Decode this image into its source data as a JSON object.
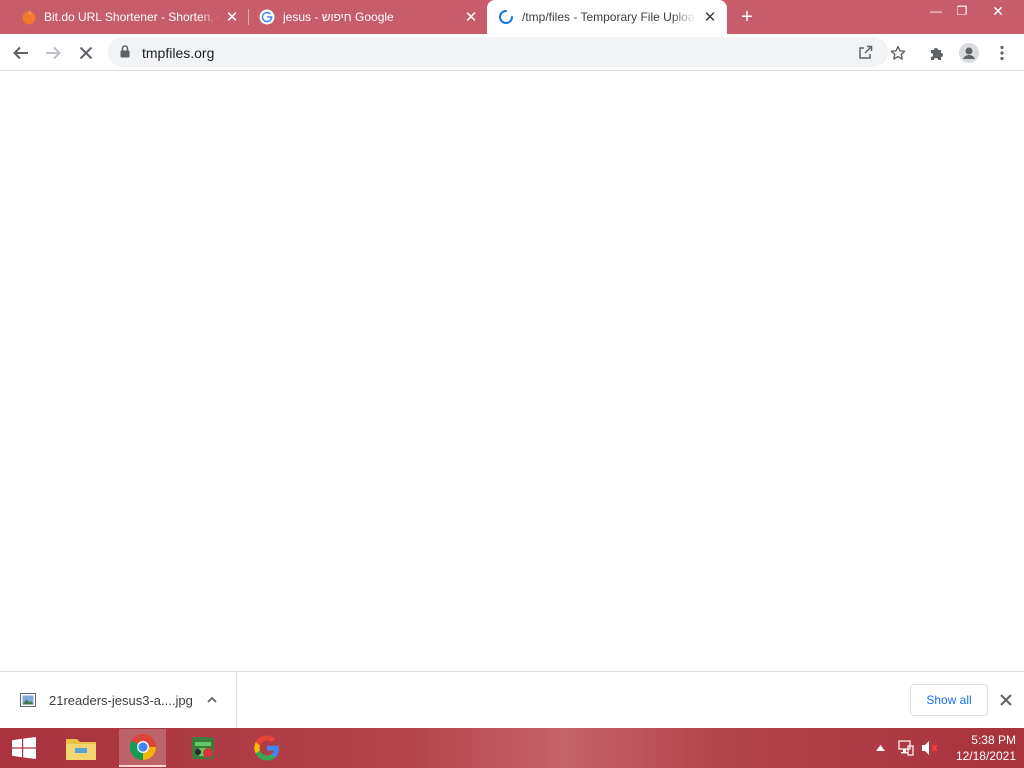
{
  "browser": {
    "tabs": [
      {
        "title": "Bit.do URL Shortener - Shorten, c",
        "favicon": "bitdo-favicon",
        "close": "✕"
      },
      {
        "title": "jesus - חיפוש Google",
        "favicon": "google-favicon",
        "close": "✕"
      },
      {
        "title": "/tmp/files - Temporary File Uploa",
        "favicon": "loading-spinner",
        "close": "✕",
        "active": true
      }
    ],
    "new_tab": "+",
    "window_controls": {
      "minimize": "—",
      "maximize": "❐",
      "close": "✕"
    }
  },
  "toolbar": {
    "url": "tmpfiles.org",
    "icons": [
      "back-icon",
      "forward-icon",
      "stop-loading-icon",
      "lock-icon",
      "share-icon",
      "bookmark-star-icon",
      "extensions-icon",
      "profile-icon",
      "menu-icon"
    ]
  },
  "downloads": {
    "file_name": "21readers-jesus3-a....jpg",
    "show_all": "Show all"
  },
  "taskbar": {
    "apps": [
      "start-button",
      "file-explorer",
      "chrome",
      "game-app",
      "google-app"
    ],
    "clock": {
      "time": "5:38 PM",
      "date": "12/18/2021"
    }
  },
  "colors": {
    "tabstrip": "#c75d6b",
    "taskbar": "#a9323c",
    "accent": "#1a73e8"
  }
}
